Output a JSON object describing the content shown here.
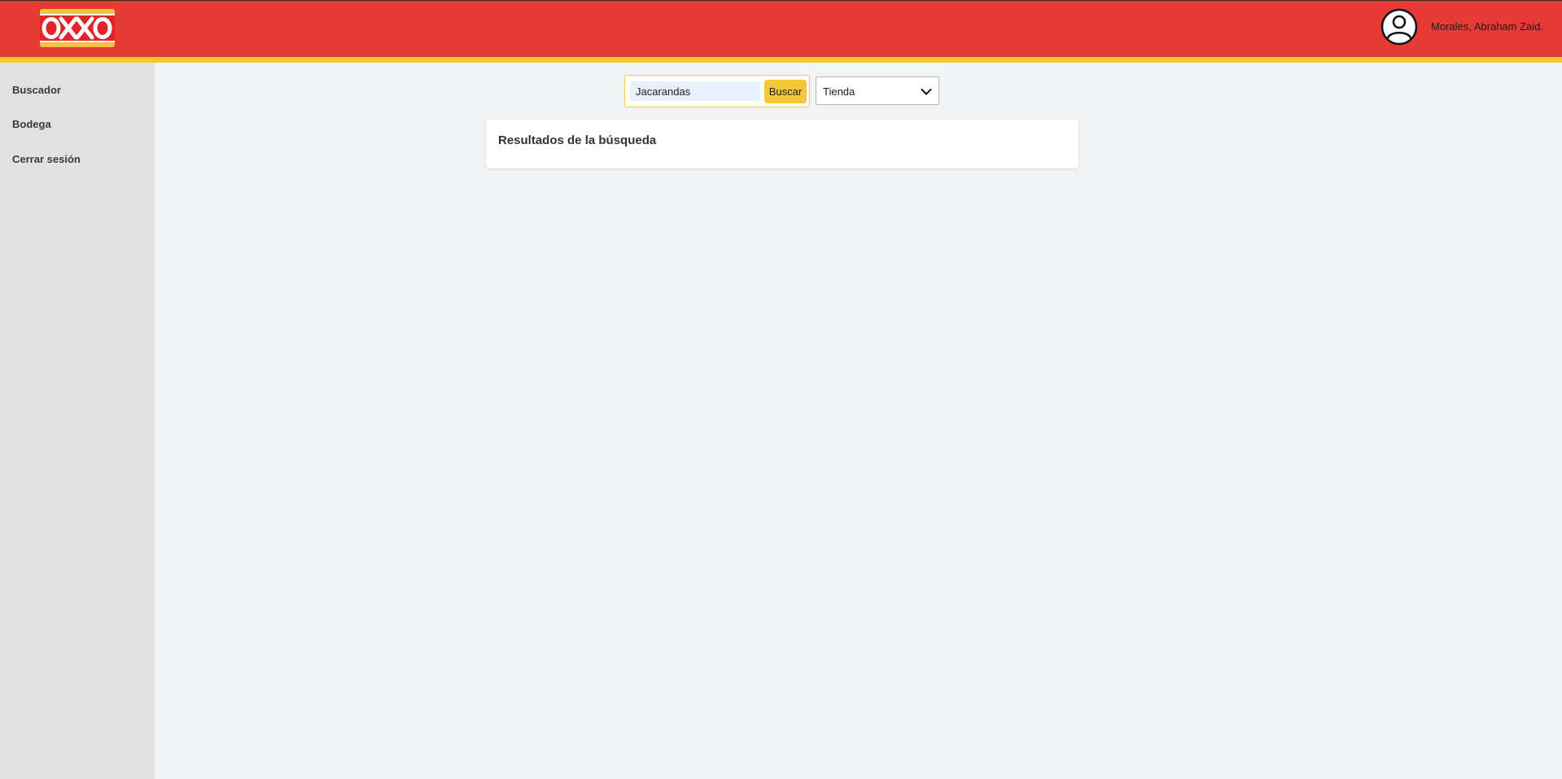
{
  "header": {
    "logo_text": "OXXO",
    "user_name": "Morales, Abraham Zaid.",
    "colors": {
      "brand_red": "#e63a36",
      "accent_yellow": "#f6c33a"
    }
  },
  "sidebar": {
    "items": [
      {
        "label": "Buscador"
      },
      {
        "label": "Bodega"
      },
      {
        "label": "Cerrar sesión"
      }
    ]
  },
  "search": {
    "value": "Jacarandas",
    "button_label": "Buscar",
    "filter_selected": "Tienda"
  },
  "results": {
    "title": "Resultados de la búsqueda"
  },
  "icons": {
    "avatar": "user-avatar-icon",
    "dropdown": "chevron-down-icon"
  }
}
